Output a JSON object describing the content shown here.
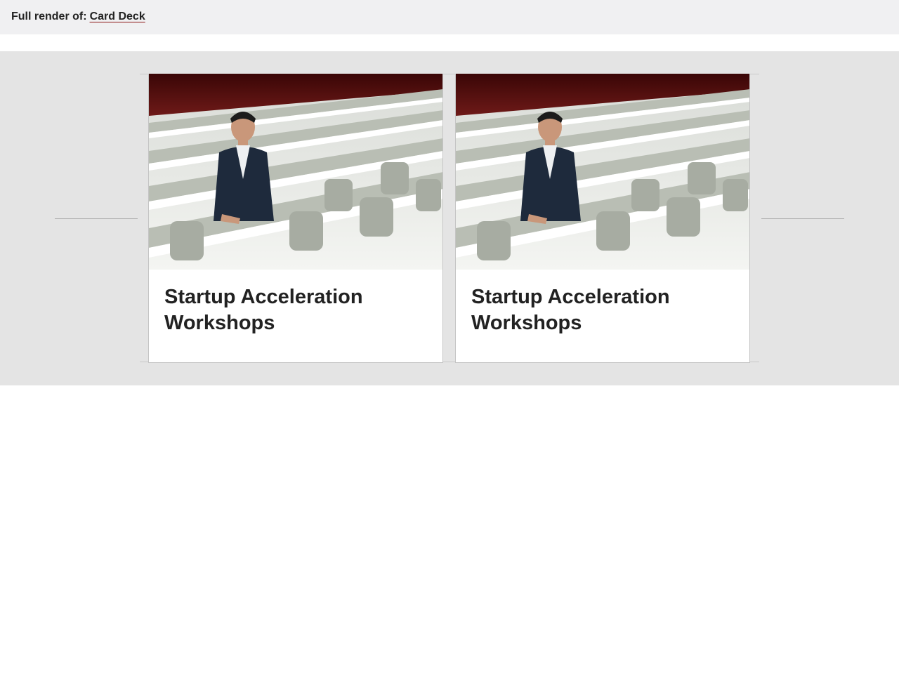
{
  "header": {
    "prefix": "Full render of:",
    "link_label": "Card Deck"
  },
  "cards": [
    {
      "title": "Startup Acceleration Workshops",
      "image": "photo of man in suit seated in lecture hall"
    },
    {
      "title": "Startup Acceleration Workshops",
      "image": "photo of man in suit seated in lecture hall"
    }
  ],
  "colors": {
    "header_bg": "#f0f0f2",
    "stage_bg": "#e4e4e4",
    "link_underline": "#8c1515",
    "text": "#222222"
  }
}
